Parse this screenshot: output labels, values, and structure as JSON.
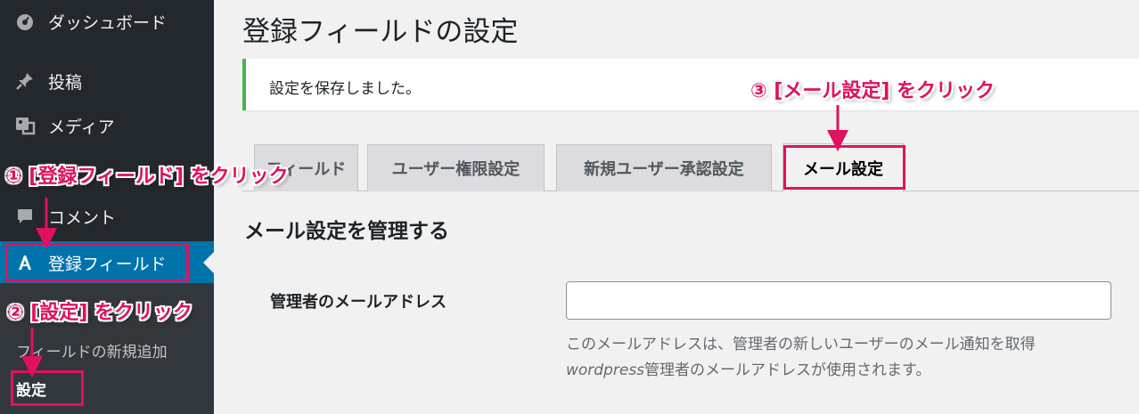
{
  "sidebar": {
    "items": [
      {
        "label": "ダッシュボード",
        "icon": "dashboard-icon"
      },
      {
        "label": "投稿",
        "icon": "pin-icon"
      },
      {
        "label": "メディア",
        "icon": "media-icon"
      },
      {
        "label": "コメント",
        "icon": "comment-icon"
      },
      {
        "label": "登録フィールド",
        "icon": "registration-fields-icon"
      }
    ],
    "submenu": [
      {
        "label": "フィールドの新規追加"
      },
      {
        "label": "設定"
      }
    ]
  },
  "page": {
    "title": "登録フィールドの設定",
    "notice": "設定を保存しました。"
  },
  "tabs": [
    {
      "label": "フィールド"
    },
    {
      "label": "ユーザー権限設定"
    },
    {
      "label": "新規ユーザー承認設定"
    },
    {
      "label": "メール設定"
    }
  ],
  "section": {
    "title": "メール設定を管理する",
    "field_label": "管理者のメールアドレス",
    "input_value": "",
    "desc_line1": "このメールアドレスは、管理者の新しいユーザーのメール通知を取得",
    "desc_line2_italic": "wordpress",
    "desc_line2_rest": "管理者のメールアドレスが使用されます。"
  },
  "annotations": {
    "step1": "① [登録フィールド] をクリック",
    "step2": "② [設定] をクリック",
    "step3": "③ [メール設定] をクリック"
  },
  "colors": {
    "sidebar_bg": "#23282d",
    "current_menu": "#0073aa",
    "success_border": "#46b450",
    "annotation": "#e0115f"
  }
}
